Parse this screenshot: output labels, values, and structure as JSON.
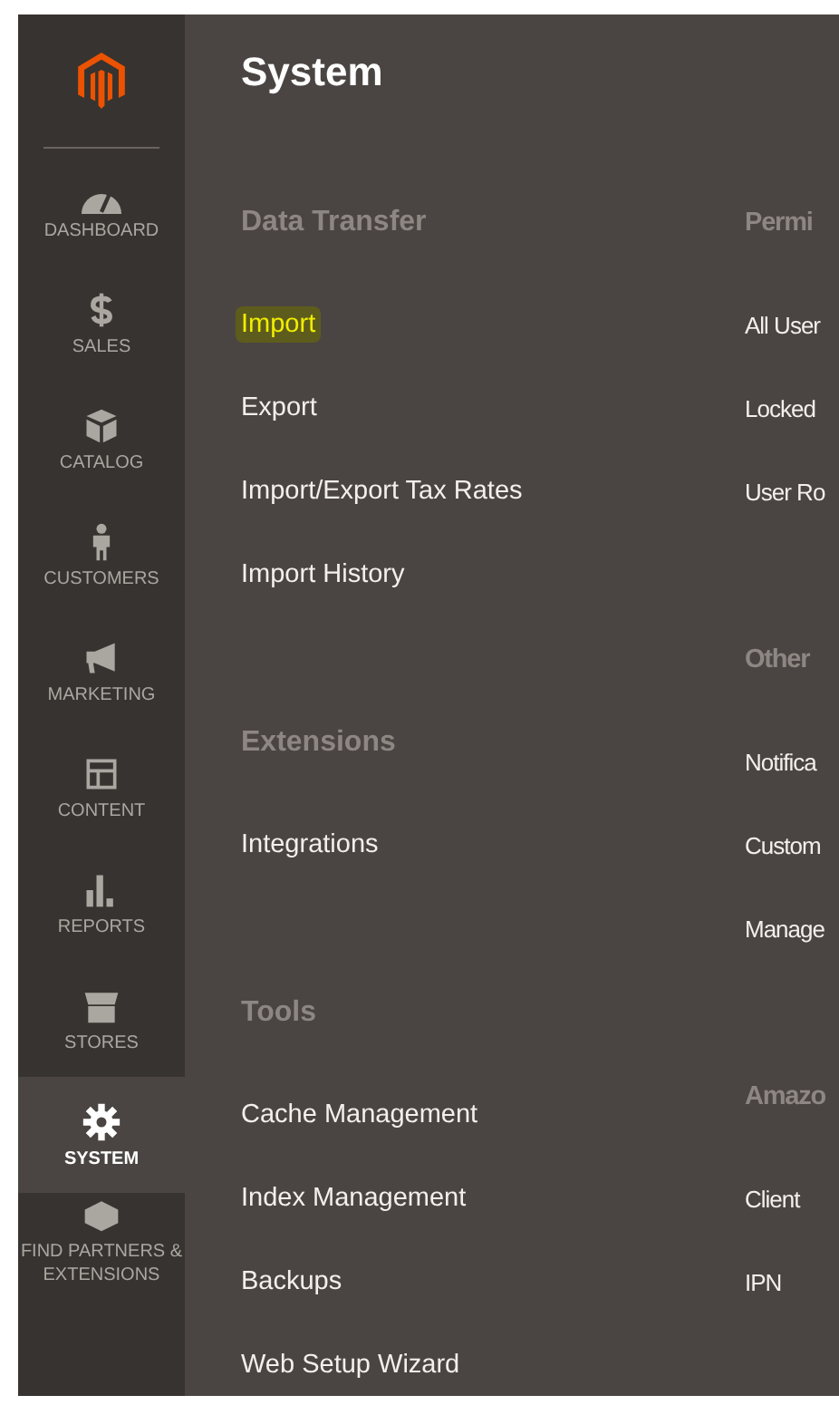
{
  "sidebar": {
    "items": [
      {
        "label": "DASHBOARD",
        "selected": false
      },
      {
        "label": "SALES",
        "selected": false
      },
      {
        "label": "CATALOG",
        "selected": false
      },
      {
        "label": "CUSTOMERS",
        "selected": false
      },
      {
        "label": "MARKETING",
        "selected": false
      },
      {
        "label": "CONTENT",
        "selected": false
      },
      {
        "label": "REPORTS",
        "selected": false
      },
      {
        "label": "STORES",
        "selected": false
      },
      {
        "label": "SYSTEM",
        "selected": true
      },
      {
        "label": "FIND PARTNERS & EXTENSIONS",
        "selected": false
      }
    ]
  },
  "page": {
    "title": "System",
    "columns": [
      [
        {
          "heading": "Data Transfer",
          "items": [
            {
              "label": "Import",
              "highlighted": true
            },
            {
              "label": "Export",
              "highlighted": false
            },
            {
              "label": "Import/Export Tax Rates",
              "highlighted": false
            },
            {
              "label": "Import History",
              "highlighted": false
            }
          ]
        },
        {
          "heading": "Extensions",
          "items": [
            {
              "label": "Integrations",
              "highlighted": false
            }
          ]
        },
        {
          "heading": "Tools",
          "items": [
            {
              "label": "Cache Management",
              "highlighted": false
            },
            {
              "label": "Index Management",
              "highlighted": false
            },
            {
              "label": "Backups",
              "highlighted": false
            },
            {
              "label": "Web Setup Wizard",
              "highlighted": false
            }
          ]
        }
      ],
      [
        {
          "heading": "Permi",
          "items": [
            {
              "label": "All User",
              "highlighted": false
            },
            {
              "label": "Locked",
              "highlighted": false
            },
            {
              "label": "User Ro",
              "highlighted": false
            }
          ]
        },
        {
          "heading": "Other",
          "items": [
            {
              "label": "Notifica",
              "highlighted": false
            },
            {
              "label": "Custom",
              "highlighted": false
            },
            {
              "label": "Manage",
              "highlighted": false
            }
          ]
        },
        {
          "heading": "Amazo",
          "items": [
            {
              "label": "Client",
              "highlighted": false
            },
            {
              "label": "IPN",
              "highlighted": false
            }
          ]
        }
      ]
    ]
  }
}
